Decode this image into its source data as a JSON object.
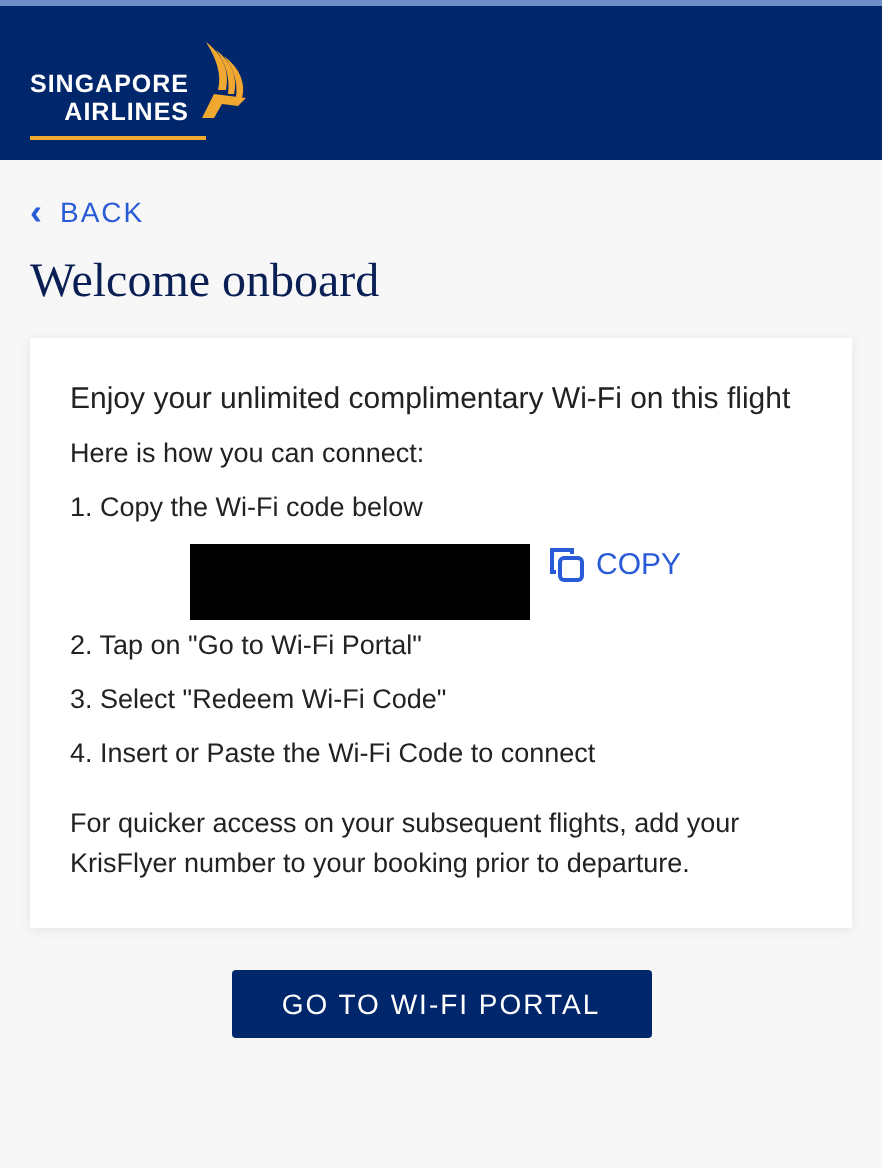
{
  "header": {
    "logo_lines": [
      "SINGAPORE",
      "AIRLINES"
    ]
  },
  "back_link": {
    "icon": "‹",
    "label": "BACK"
  },
  "title": "Welcome onboard",
  "card": {
    "heading": "Enjoy your unlimited complimentary Wi-Fi on this flight",
    "intro": "Here is how you can connect:",
    "steps": [
      "1. Copy the Wi-Fi code below",
      "2. Tap on \"Go to Wi-Fi Portal\"",
      "3. Select \"Redeem Wi-Fi Code\"",
      "4. Insert or Paste the Wi-Fi Code to connect"
    ],
    "wifi_code": {
      "redacted": true
    },
    "copy_button": "COPY",
    "note": "For quicker access on your subsequent flights, add your KrisFlyer number to your booking prior to departure."
  },
  "primary_button": "GO TO WI-FI PORTAL"
}
